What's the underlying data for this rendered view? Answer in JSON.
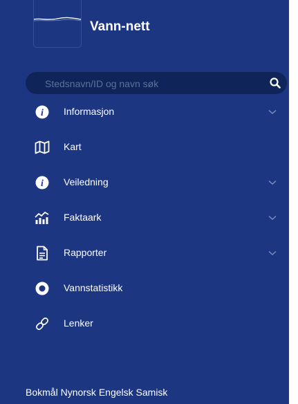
{
  "app": {
    "title": "Vann-nett"
  },
  "search": {
    "placeholder": "Stedsnavn/ID og navn søk",
    "value": ""
  },
  "menu": {
    "items": [
      {
        "label": "Informasjon",
        "icon": "info-circle-icon",
        "expandable": true
      },
      {
        "label": "Kart",
        "icon": "map-icon",
        "expandable": false
      },
      {
        "label": "Veiledning",
        "icon": "info-circle-icon",
        "expandable": true
      },
      {
        "label": "Faktaark",
        "icon": "chart-icon",
        "expandable": true
      },
      {
        "label": "Rapporter",
        "icon": "document-icon",
        "expandable": true
      },
      {
        "label": "Vannstatistikk",
        "icon": "ring-icon",
        "expandable": false
      },
      {
        "label": "Lenker",
        "icon": "link-icon",
        "expandable": false
      }
    ]
  },
  "languages": [
    "Bokmål",
    "Nynorsk",
    "Engelsk",
    "Samisk"
  ],
  "colors": {
    "sidebar_bg": "#1c3682",
    "search_bg": "#0f2559",
    "text": "#ffffff",
    "chevron": "#7a8dbd"
  }
}
